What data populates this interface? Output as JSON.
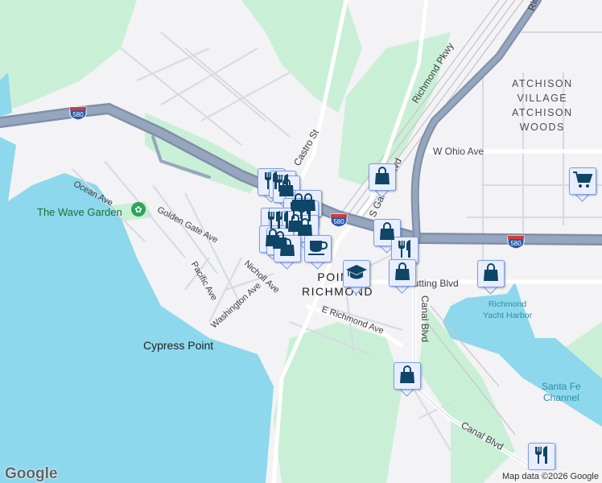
{
  "map": {
    "labels": {
      "atchison_village": "ATCHISON\nVILLAGE",
      "atchison_woods": "ATCHISON\nWOODS",
      "w_ohio": "W Ohio Ave",
      "richmond_pkwy": "Richmond Pkwy",
      "castro": "Castro St",
      "ocean": "Ocean Ave",
      "golden_gate": "Golden Gate Ave",
      "pacific": "Pacific Ave",
      "nicholl": "Nicholl Ave",
      "washington": "Washington Ave",
      "e_richmond": "E Richmond Ave",
      "cutting": "Cutting Blvd",
      "canal1": "Canal Blvd",
      "canal2": "Canal Blvd",
      "s_garrard": "S Garrard Blvd",
      "point_richmond": "POINT\nRICHMOND",
      "cypress": "Cypress Point",
      "wave_garden": "The Wave Garden",
      "yacht": "Richmond\nYacht Harbor",
      "santa_fe": "Santa Fe\nChannel",
      "rich_top": "Richmond"
    },
    "highway_shield": "580",
    "colors": {
      "water": "#8dd8ec",
      "park": "#c9f0d6",
      "land": "#f3f2f4",
      "highway": "#8a9bb5",
      "marker_icon": "#0f4566"
    },
    "markers": [
      {
        "type": "restaurant"
      },
      {
        "type": "restaurant"
      },
      {
        "type": "shopping"
      },
      {
        "type": "shopping"
      },
      {
        "type": "shopping"
      },
      {
        "type": "restaurant"
      },
      {
        "type": "restaurant"
      },
      {
        "type": "restaurant"
      },
      {
        "type": "restaurant"
      },
      {
        "type": "shopping"
      },
      {
        "type": "shopping"
      },
      {
        "type": "shopping"
      },
      {
        "type": "shopping"
      },
      {
        "type": "shopping"
      },
      {
        "type": "coffee"
      },
      {
        "type": "shopping"
      },
      {
        "type": "shopping"
      },
      {
        "type": "restaurant"
      },
      {
        "type": "shopping"
      },
      {
        "type": "school"
      },
      {
        "type": "shopping"
      },
      {
        "type": "grocery"
      },
      {
        "type": "shopping"
      },
      {
        "type": "restaurant"
      }
    ]
  },
  "logo": "Google",
  "attribution": "Map data ©2026 Google"
}
